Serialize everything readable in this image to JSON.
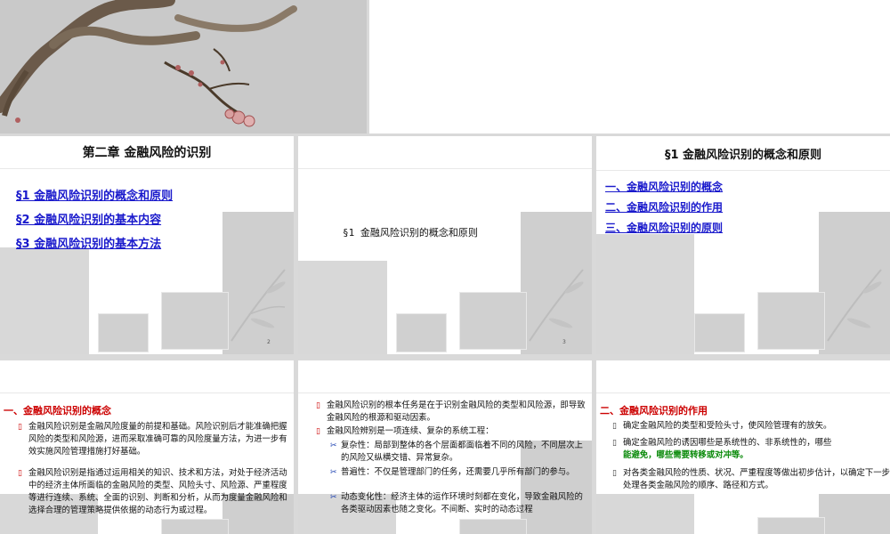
{
  "slide2": {
    "chapter_title": "第二章  金融风险的识别",
    "links": [
      "§1  金融风险识别的概念和原则",
      "§2  金融风险识别的基本内容",
      "§3  金融风险识别的基本方法"
    ],
    "page_number": "2"
  },
  "slide3": {
    "center_title": "§1  金融风险识别的概念和原则",
    "page_number": "3"
  },
  "slide4": {
    "title": "§1  金融风险识别的概念和原则",
    "links": [
      "一、金融风险识别的概念",
      "二、金融风险识别的作用",
      "三、金融风险识别的原则"
    ]
  },
  "slide5": {
    "heading": "一、金融风险识别的概念",
    "bullet_icon": "square-bullet-icon",
    "paragraphs": [
      "金融风险识别是金融风险度量的前提和基础。风险识别后才能准确把握风险的类型和风险源，进而采取准确可靠的风险度量方法，为进一步有效实施风险管理措施打好基础。",
      "金融风险识别是指通过运用相关的知识、技术和方法，对处于经济活动中的经济主体所面临的金融风险的类型、风险头寸、风险源、严重程度等进行连续、系统、全面的识别、判断和分析，从而为度量金融风险和选择合理的管理策略提供依据的动态行为或过程。"
    ]
  },
  "slide6": {
    "paragraphs": [
      "金融风险识别的根本任务是在于识别金融风险的类型和风险源，即导致金融风险的根源和驱动因素。",
      "金融风险辨别是一项连续、复杂的系统工程："
    ],
    "sub_bullet_icon": "scissors-bullet-icon",
    "sub_items": [
      "复杂性：局部到整体的各个层面都面临着不同的风险，不同层次上的风险又纵横交错、异常复杂。",
      "普遍性：不仅是管理部门的任务，还需要几乎所有部门的参与。",
      "动态变化性：经济主体的运作环境时刻都在变化，导致金融风险的各类驱动因素也随之变化。不间断、实时的动态过程"
    ]
  },
  "slide7": {
    "heading": "二、金融风险识别的作用",
    "paragraphs": [
      "确定金融风险的类型和受险头寸，使风险管理有的放矢。",
      "确定金融风险的诱因哪些是系统性的、非系统性的，哪些",
      "对各类金融风险的性质、状况、严重程度等做出初步估计，以确定下一步处理各类金融风险的顺序、路径和方式。"
    ],
    "green_text": "能避免，哪些需要转移或对冲等。"
  }
}
